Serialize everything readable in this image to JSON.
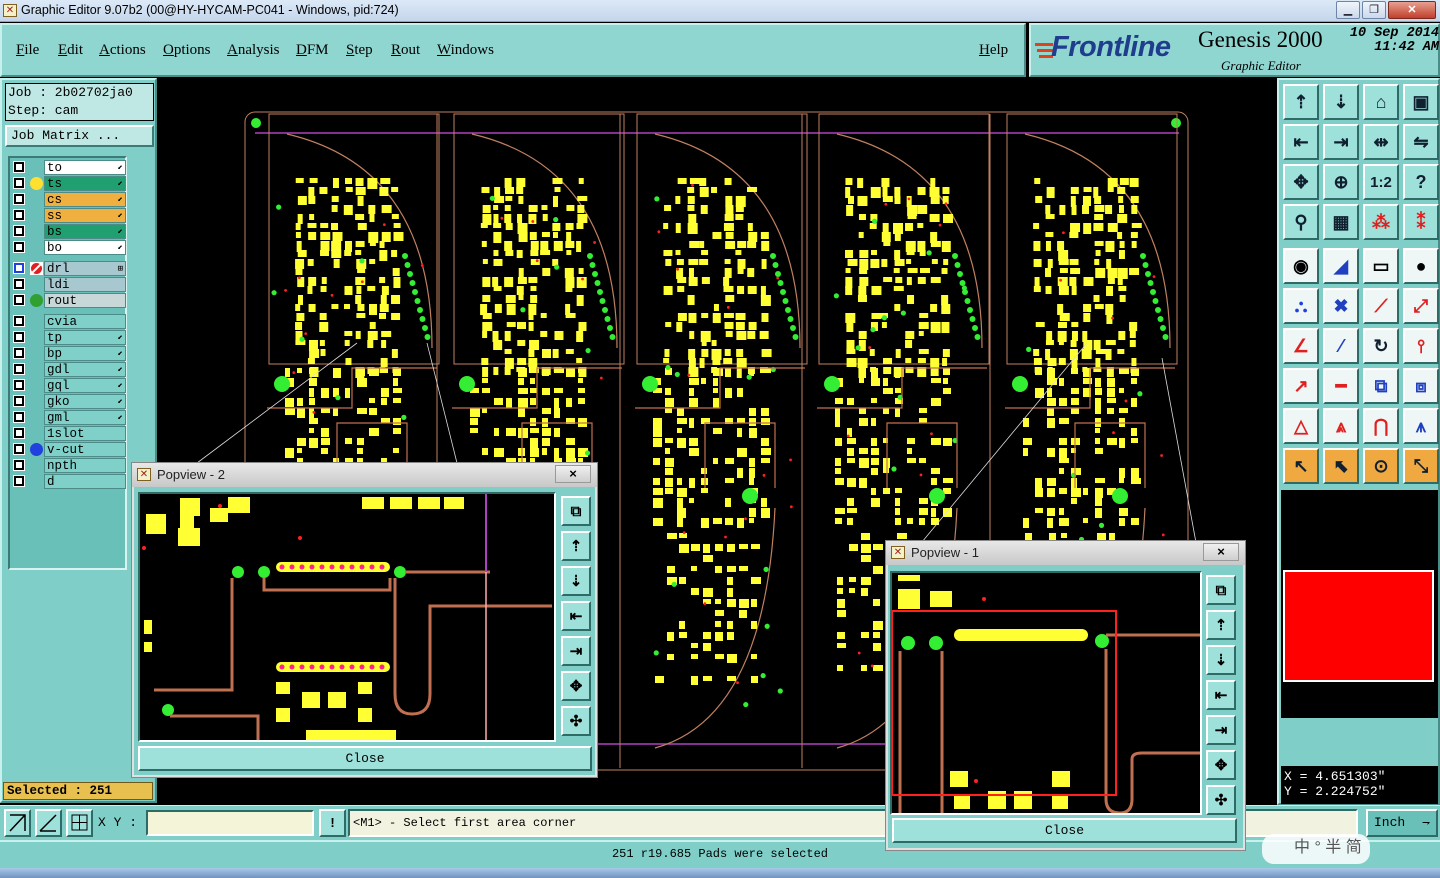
{
  "window": {
    "title": "Graphic Editor 9.07b2 (00@HY-HYCAM-PC041 - Windows, pid:724)",
    "app_icon": "app-icon"
  },
  "menu": {
    "items": [
      "File",
      "Edit",
      "Actions",
      "Options",
      "Analysis",
      "DFM",
      "Step",
      "Rout",
      "Windows"
    ],
    "help": "Help"
  },
  "brand": {
    "logo": "Frontline",
    "product": "Genesis 2000",
    "subtitle": "Graphic Editor",
    "date_line1": "10 Sep 2014",
    "date_line2": "11:42 AM"
  },
  "job": {
    "job_line": "Job : 2b02702ja0",
    "step_line": "Step: cam",
    "matrix_button": "Job Matrix ..."
  },
  "layers": [
    {
      "name": "to",
      "color": "#ffffff",
      "dot": "",
      "marker": "⬋"
    },
    {
      "name": "ts",
      "color": "#20a070",
      "dot": "#ffe030",
      "marker": "⬋"
    },
    {
      "name": "cs",
      "color": "#f0b040",
      "dot": "",
      "marker": "⬋"
    },
    {
      "name": "ss",
      "color": "#f0b040",
      "dot": "",
      "marker": "⬋"
    },
    {
      "name": "bs",
      "color": "#20a070",
      "dot": "",
      "marker": "⬋"
    },
    {
      "name": "bo",
      "color": "#ffffff",
      "dot": "",
      "marker": "⬋"
    },
    {
      "name": "drl",
      "color": "#a8c8d0",
      "dot": "drl",
      "marker": "⊞"
    },
    {
      "name": "ldi",
      "color": "#a8c8d0",
      "dot": "",
      "marker": ""
    },
    {
      "name": "rout",
      "color": "#c8d8d8",
      "dot": "#30a030",
      "marker": ""
    },
    {
      "name": "cvia",
      "color": "#7fd0c8",
      "dot": "",
      "marker": ""
    },
    {
      "name": "tp",
      "color": "#7fd0c8",
      "dot": "",
      "marker": "⬋"
    },
    {
      "name": "bp",
      "color": "#7fd0c8",
      "dot": "",
      "marker": "⬋"
    },
    {
      "name": "gdl",
      "color": "#7fd0c8",
      "dot": "",
      "marker": "⬋"
    },
    {
      "name": "gql",
      "color": "#7fd0c8",
      "dot": "",
      "marker": "⬋"
    },
    {
      "name": "gko",
      "color": "#7fd0c8",
      "dot": "",
      "marker": "⬋"
    },
    {
      "name": "gml",
      "color": "#7fd0c8",
      "dot": "",
      "marker": "⬋"
    },
    {
      "name": "1slot",
      "color": "#7fd0c8",
      "dot": "",
      "marker": ""
    },
    {
      "name": "v-cut",
      "color": "#7fd0c8",
      "dot": "#2040e0",
      "marker": ""
    },
    {
      "name": "npth",
      "color": "#7fd0c8",
      "dot": "",
      "marker": ""
    },
    {
      "name": "d",
      "color": "#7fd0c8",
      "dot": "",
      "marker": ""
    }
  ],
  "selected_count": "Selected : 251",
  "toolbar_icons": [
    "zoom-home-icon",
    "zoom-out-icon",
    "house-icon",
    "window-icon",
    "pan-left-icon",
    "pan-right-icon",
    "pan-center-icon",
    "flip-icon",
    "zoom-fit-icon",
    "zoom-center-icon",
    "scale-1-2-icon",
    "help-icon",
    "snap-icon",
    "grid-icon",
    "layer-toggle-icon",
    "layer-settings-icon",
    "pad-icon",
    "line-draw-icon",
    "measure-icon",
    "circle-icon",
    "net-icon",
    "cross-icon",
    "route-icon",
    "connect-icon",
    "angle-icon",
    "slash-icon",
    "rotate-icon",
    "mirror-icon",
    "move-icon",
    "line-icon",
    "copy-icon",
    "group-icon",
    "triangle-icon",
    "triangle-up-icon",
    "arch-icon",
    "compass-icon",
    "pointer-icon",
    "select-icon",
    "select-circle-icon",
    "select-multi-icon"
  ],
  "scale_label": "1:2",
  "coords": {
    "x": "X = 4.651303\"",
    "y": "Y = 2.224752\""
  },
  "command": {
    "xy_label": "X Y :",
    "xy_value": "",
    "prompt": "<M1> - Select first area corner",
    "unit": "Inch",
    "unit_arrow": "⇁"
  },
  "status": "251 r19.685 Pads were selected",
  "ime": "中 ° 半 简",
  "popview2": {
    "title": "Popview - 2",
    "close_x": "×",
    "close_label": "Close"
  },
  "popview1": {
    "title": "Popview - 1",
    "close_x": "×",
    "close_label": "Close"
  },
  "colors": {
    "pad": "#ffff33",
    "via": "#33ee33",
    "trace": "#c07050",
    "outline": "#c08060",
    "vcut": "#b040c0",
    "selection": "#ff2020"
  }
}
